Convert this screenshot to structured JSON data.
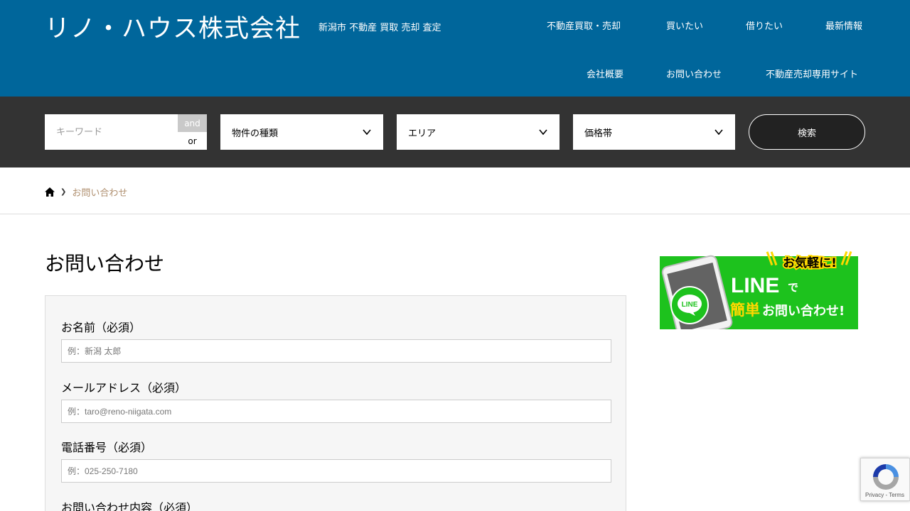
{
  "header": {
    "logo": "リノ・ハウス株式会社",
    "tagline": "新潟市 不動産 買取 売却 査定",
    "nav": [
      "不動産買取・売却",
      "買いたい",
      "借りたい",
      "最新情報",
      "会社概要",
      "お問い合わせ",
      "不動産売却専用サイト"
    ]
  },
  "search": {
    "keyword_placeholder": "キーワード",
    "and_label": "and",
    "or_label": "or",
    "property_type": "物件の種類",
    "area": "エリア",
    "price_range": "価格帯",
    "submit_label": "検索"
  },
  "breadcrumb": {
    "home_icon": "home-icon",
    "current": "お問い合わせ"
  },
  "main": {
    "title": "お問い合わせ",
    "fields": [
      {
        "label": "お名前（必須）",
        "placeholder": "例：新潟 太郎"
      },
      {
        "label": "メールアドレス（必須）",
        "placeholder": "例：taro@reno-niigata.com"
      },
      {
        "label": "電話番号（必須）",
        "placeholder": "例：025-250-7180"
      },
      {
        "label": "お問い合わせ内容（必須）"
      }
    ]
  },
  "sidebar": {
    "line_banner": {
      "badge": "お気軽に!",
      "brand": "LINE",
      "connector": "で",
      "highlight": "簡単",
      "text": "お問い合わせ!",
      "icon_text": "LINE"
    }
  },
  "recaptcha": {
    "links": "Privacy - Terms"
  },
  "colors": {
    "header_bg": "#00669b",
    "search_bg": "#333333",
    "line_green": "#1dc21d",
    "breadcrumb_current": "#b09070"
  }
}
